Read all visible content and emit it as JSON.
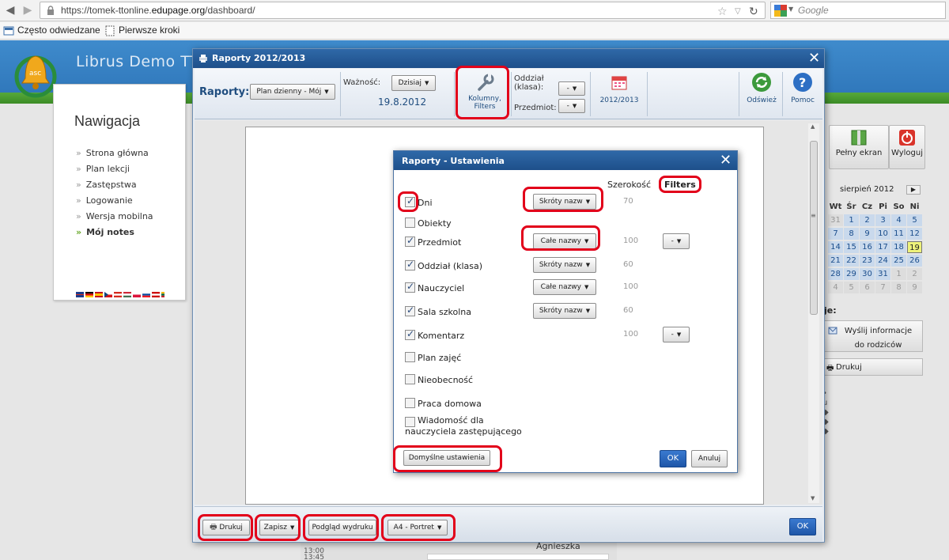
{
  "browser": {
    "url_prefix": "https://tomek-ttonline.",
    "url_domain": "edupage.org",
    "url_path": "/dashboard/",
    "search_placeholder": "Google",
    "bookmarks": [
      "Często odwiedzane",
      "Pierwsze kroki"
    ]
  },
  "site": {
    "brand": "Librus Demo TTO",
    "nav_title": "Nawigacja",
    "nav_items": [
      "Strona główna",
      "Plan lekcji",
      "Zastępstwa",
      "Logowanie",
      "Wersja mobilna",
      "Mój notes"
    ],
    "right_buttons": [
      "Pełny ekran",
      "Wyloguj"
    ],
    "calendar": {
      "month": "sierpień 2012",
      "days_header": [
        "Wt",
        "Śr",
        "Cz",
        "Pi",
        "So",
        "Ni"
      ],
      "rows": [
        [
          "31",
          "1",
          "2",
          "3",
          "4",
          "5"
        ],
        [
          "7",
          "8",
          "9",
          "10",
          "11",
          "12"
        ],
        [
          "14",
          "15",
          "16",
          "17",
          "18",
          "19"
        ],
        [
          "21",
          "22",
          "23",
          "24",
          "25",
          "26"
        ],
        [
          "28",
          "29",
          "30",
          "31",
          "1",
          "2"
        ],
        [
          "4",
          "5",
          "6",
          "7",
          "8",
          "9"
        ]
      ],
      "today": "19"
    },
    "right_label": "je:",
    "send_info": "Wyślij informacje do rodziców",
    "print_small": "Drukuj",
    "bg_bottom_name": "Agnieszka",
    "bg_times": [
      "13:00",
      "13:45"
    ]
  },
  "dialog": {
    "title": "Raporty 2012/2013",
    "toolbar": {
      "reports_label": "Raporty:",
      "reports_value": "Plan dzienny - Mój",
      "validity_label": "Ważność:",
      "validity_value": "Dzisiaj",
      "date": "19.8.2012",
      "columns_btn": "Kolumny, Filters",
      "class_label": "Oddział (klasa):",
      "class_value": "-",
      "subject_label": "Przedmiot:",
      "subject_value": "-",
      "year_btn": "2012/2013",
      "refresh_btn": "Odśwież",
      "help_btn": "Pomoc"
    },
    "bottom": {
      "print": "Drukuj",
      "save": "Zapisz",
      "preview": "Podgląd wydruku",
      "paper": "A4 - Portret",
      "ok": "OK"
    }
  },
  "settings": {
    "title": "Raporty - Ustawienia",
    "width_header": "Szerokość",
    "filters_header": "Filters",
    "rows": [
      {
        "label": "Dni",
        "checked": true,
        "format": "Skróty nazw",
        "width": "70",
        "filter": ""
      },
      {
        "label": "Obiekty",
        "checked": false,
        "format": "",
        "width": "",
        "filter": ""
      },
      {
        "label": "Przedmiot",
        "checked": true,
        "format": "Całe nazwy",
        "width": "100",
        "filter": "-"
      },
      {
        "label": "Oddział (klasa)",
        "checked": true,
        "format": "Skróty nazw",
        "width": "60",
        "filter": ""
      },
      {
        "label": "Nauczyciel",
        "checked": true,
        "format": "Całe nazwy",
        "width": "100",
        "filter": ""
      },
      {
        "label": "Sala szkolna",
        "checked": true,
        "format": "Skróty nazw",
        "width": "60",
        "filter": ""
      },
      {
        "label": "Komentarz",
        "checked": true,
        "format": "",
        "width": "100",
        "filter": "-"
      },
      {
        "label": "Plan zajęć",
        "checked": false,
        "format": "",
        "width": "",
        "filter": ""
      },
      {
        "label": "Nieobecność",
        "checked": false,
        "format": "",
        "width": "",
        "filter": ""
      },
      {
        "label": "Praca domowa",
        "checked": false,
        "format": "",
        "width": "",
        "filter": ""
      },
      {
        "label": "Wiadomość dla nauczyciela zastępującego",
        "checked": false,
        "format": "",
        "width": "",
        "filter": ""
      }
    ],
    "defaults_btn": "Domyślne ustawienia",
    "ok_btn": "OK",
    "cancel_btn": "Anuluj"
  },
  "colors": {
    "highlight": "#e2001a",
    "title_bar": "#1e4f8a",
    "ok_blue": "#1e56a8"
  }
}
